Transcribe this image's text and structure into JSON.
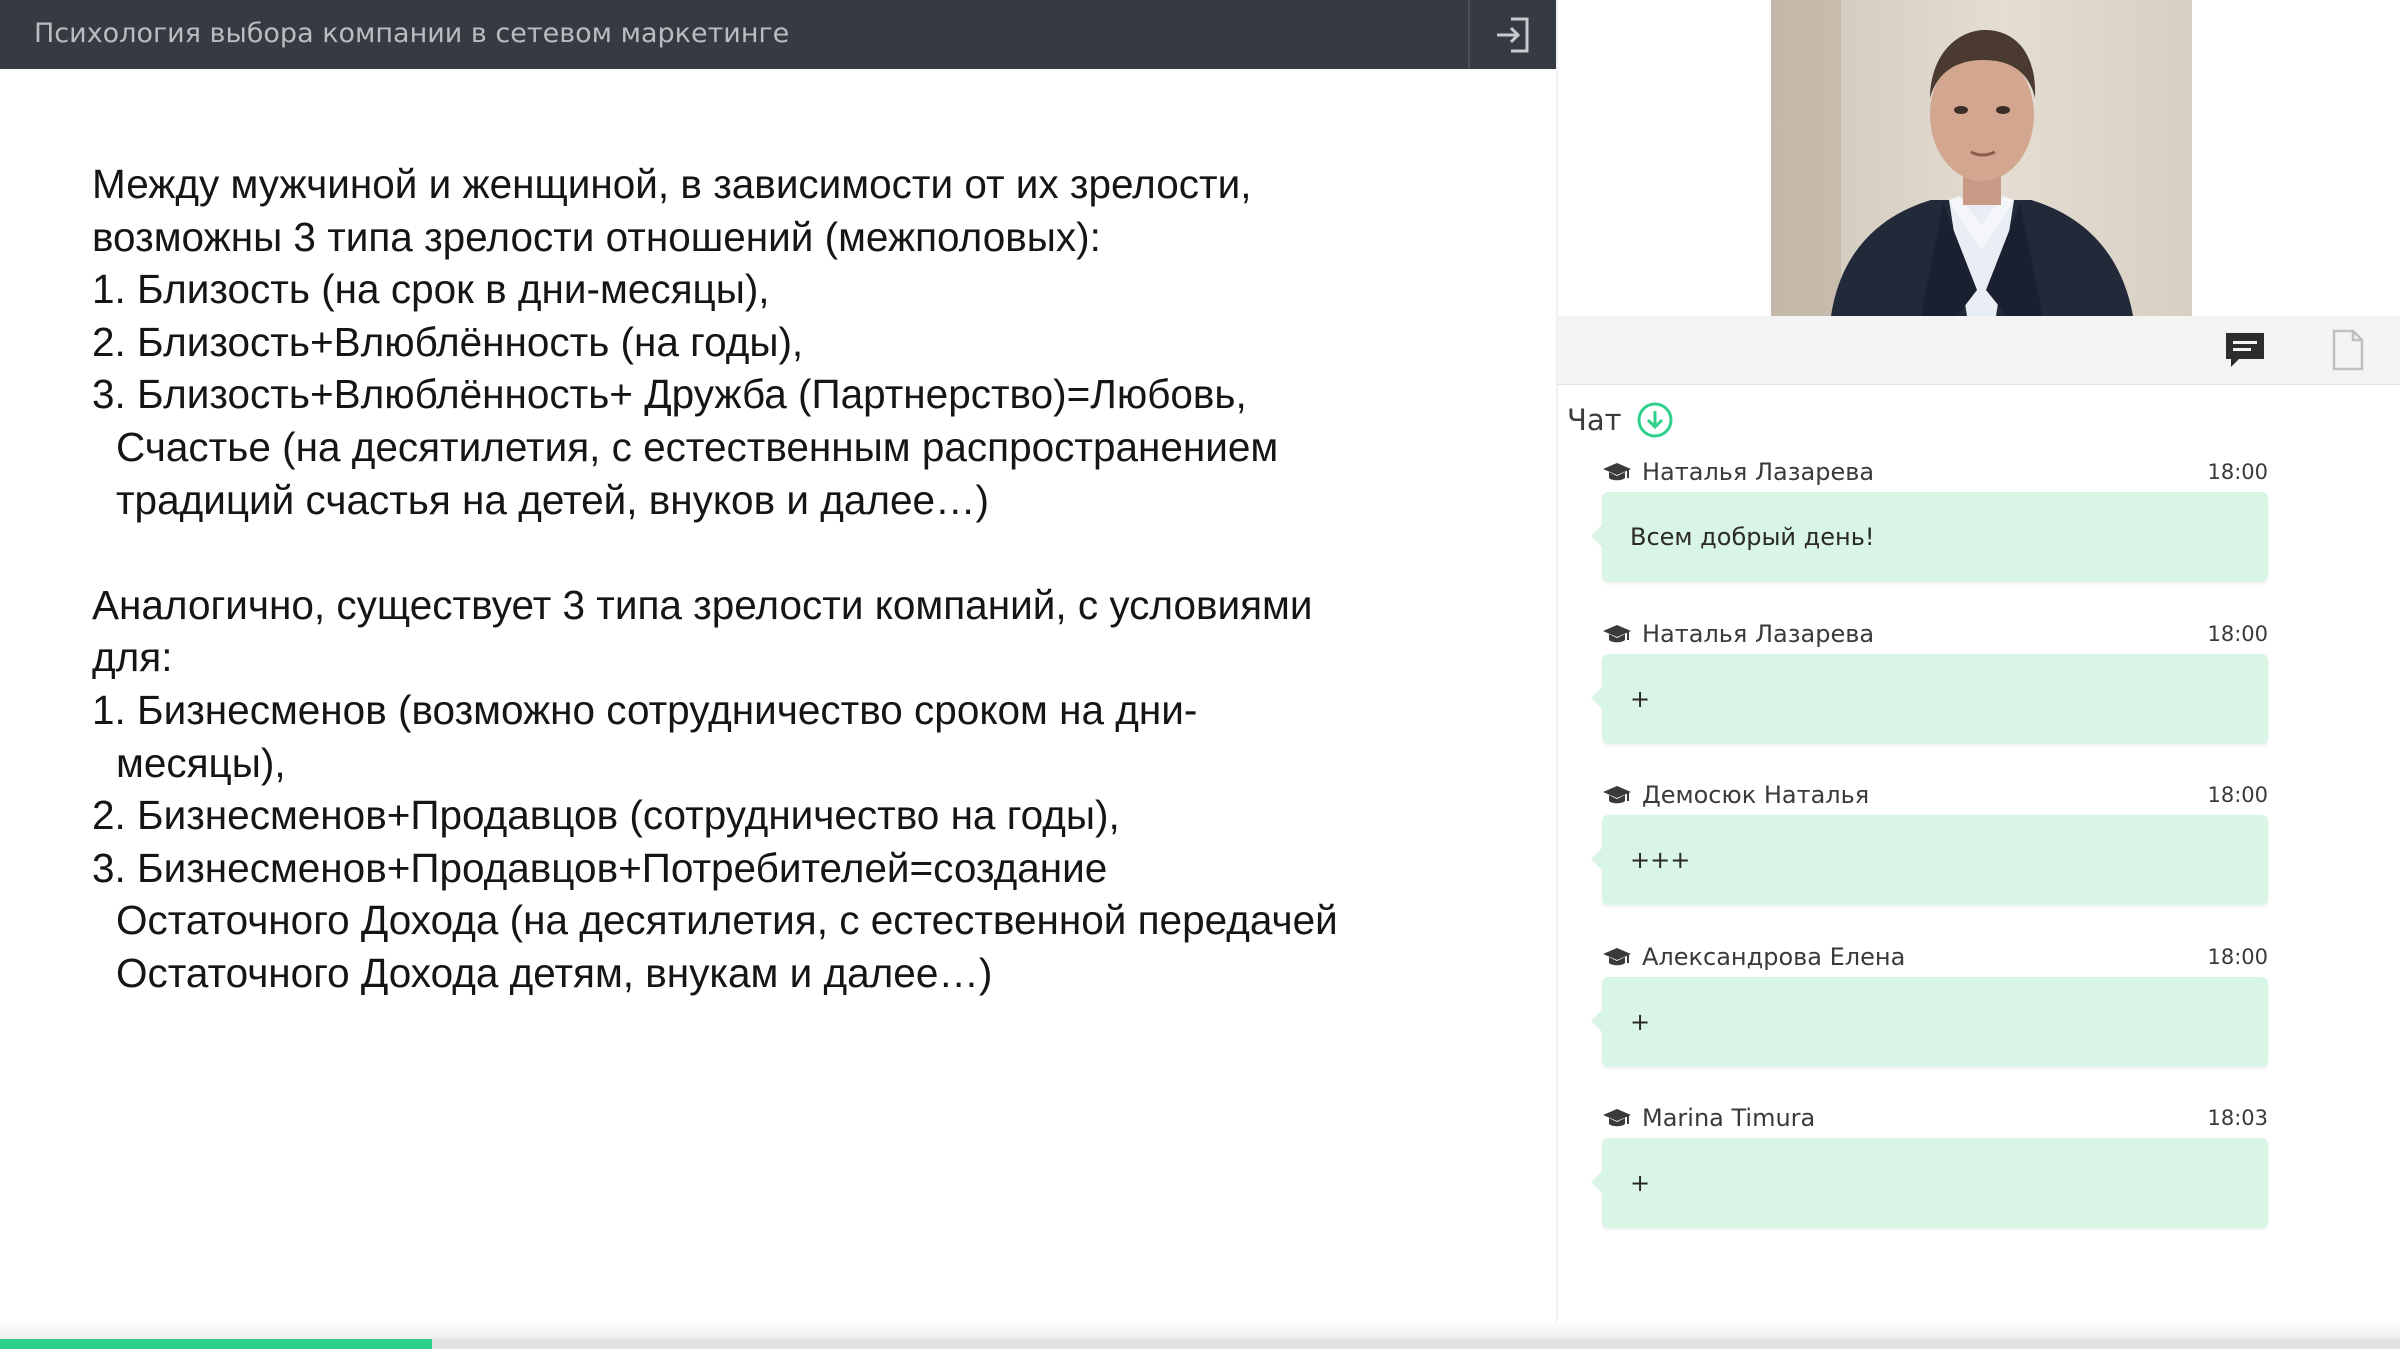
{
  "header": {
    "title": "Психология выбора компании в сетевом маркетинге",
    "exit_icon": "exit-icon"
  },
  "slide": {
    "p1_line1": "Между мужчиной и женщиной, в зависимости от их зрелости,",
    "p1_line2": "возможны 3 типа зрелости отношений (межполовых):",
    "p1_item1": "1. Близость (на срок в дни-месяцы),",
    "p1_item2": "2. Близость+Влюблённость (на годы),",
    "p1_item3_l1": "3. Близость+Влюблённость+ Дружба (Партнерство)=Любовь,",
    "p1_item3_l2": "Счастье (на десятилетия, с естественным распространением",
    "p1_item3_l3": "традиций счастья на детей, внуков и далее…)",
    "p2_line1": "Аналогично, существует 3 типа зрелости компаний, с условиями",
    "p2_line2": "для:",
    "p2_item1_l1": "1. Бизнесменов (возможно сотрудничество сроком на дни-",
    "p2_item1_l2": "месяцы),",
    "p2_item2": "2. Бизнесменов+Продавцов (сотрудничество на годы),",
    "p2_item3_l1": "3. Бизнесменов+Продавцов+Потребителей=создание",
    "p2_item3_l2": "Остаточного Дохода (на десятилетия, с естественной передачей",
    "p2_item3_l3": "Остаточного Дохода детям, внукам и далее…)"
  },
  "tabs": {
    "chat_icon": "chat-bubble-icon",
    "files_icon": "document-icon"
  },
  "chat": {
    "title": "Чат",
    "scroll_icon": "arrow-down-circle-icon",
    "author_icon": "graduation-cap-icon",
    "messages": [
      {
        "author": "Наталья Лазарева",
        "time": "18:00",
        "text": "Всем добрый день!"
      },
      {
        "author": "Наталья Лазарева",
        "time": "18:00",
        "text": "+"
      },
      {
        "author": "Демосюк Наталья",
        "time": "18:00",
        "text": "+++"
      },
      {
        "author": "Александрова Елена",
        "time": "18:00",
        "text": "+"
      },
      {
        "author": "Marina Timura",
        "time": "18:03",
        "text": "+"
      }
    ]
  },
  "video": {
    "content": "presenter-video-feed"
  },
  "progress": {
    "fraction": 0.18
  },
  "colors": {
    "topbar": "#363a41",
    "accent": "#2fcf8c",
    "bubble": "#d9f5e6"
  }
}
